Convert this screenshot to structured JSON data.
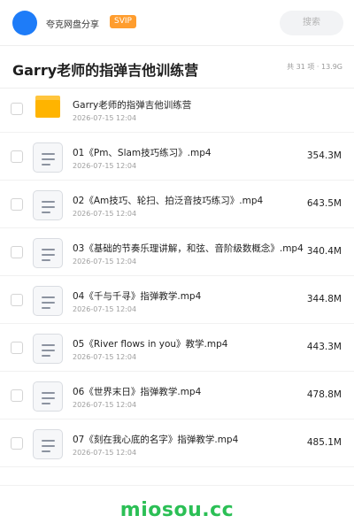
{
  "header": {
    "brand": "夸克网盘分享",
    "badge": "SVIP",
    "search_label": "搜索"
  },
  "folder": {
    "title": "Garry老师的指弹吉他训练营",
    "summary": "共 31 项 · 13.9G"
  },
  "items": [
    {
      "type": "folder",
      "name": "Garry老师的指弹吉他训练营",
      "date": "2026-07-15 12:04",
      "size": ""
    },
    {
      "type": "file",
      "name": "01《Pm、Slam技巧练习》.mp4",
      "date": "2026-07-15 12:04",
      "size": "354.3M"
    },
    {
      "type": "file",
      "name": "02《Am技巧、轮扫、拍泛音技巧练习》.mp4",
      "date": "2026-07-15 12:04",
      "size": "643.5M"
    },
    {
      "type": "file",
      "name": "03《基础的节奏乐理讲解，和弦、音阶级数概念》.mp4",
      "date": "2026-07-15 12:04",
      "size": "340.4M"
    },
    {
      "type": "file",
      "name": "04《千与千寻》指弹教学.mp4",
      "date": "2026-07-15 12:04",
      "size": "344.8M"
    },
    {
      "type": "file",
      "name": "05《River flows in you》教学.mp4",
      "date": "2026-07-15 12:04",
      "size": "443.3M"
    },
    {
      "type": "file",
      "name": "06《世界末日》指弹教学.mp4",
      "date": "2026-07-15 12:04",
      "size": "478.8M"
    },
    {
      "type": "file",
      "name": "07《刻在我心底的名字》指弹教学.mp4",
      "date": "2026-07-15 12:04",
      "size": "485.1M"
    }
  ],
  "footer": {
    "watermark": "miosou.cc"
  },
  "colors": {
    "accent_blue": "#1e7cf8",
    "svip_orange": "#ff9d2e",
    "folder_yellow": "#ffb400",
    "watermark_green": "#2bbf55"
  }
}
